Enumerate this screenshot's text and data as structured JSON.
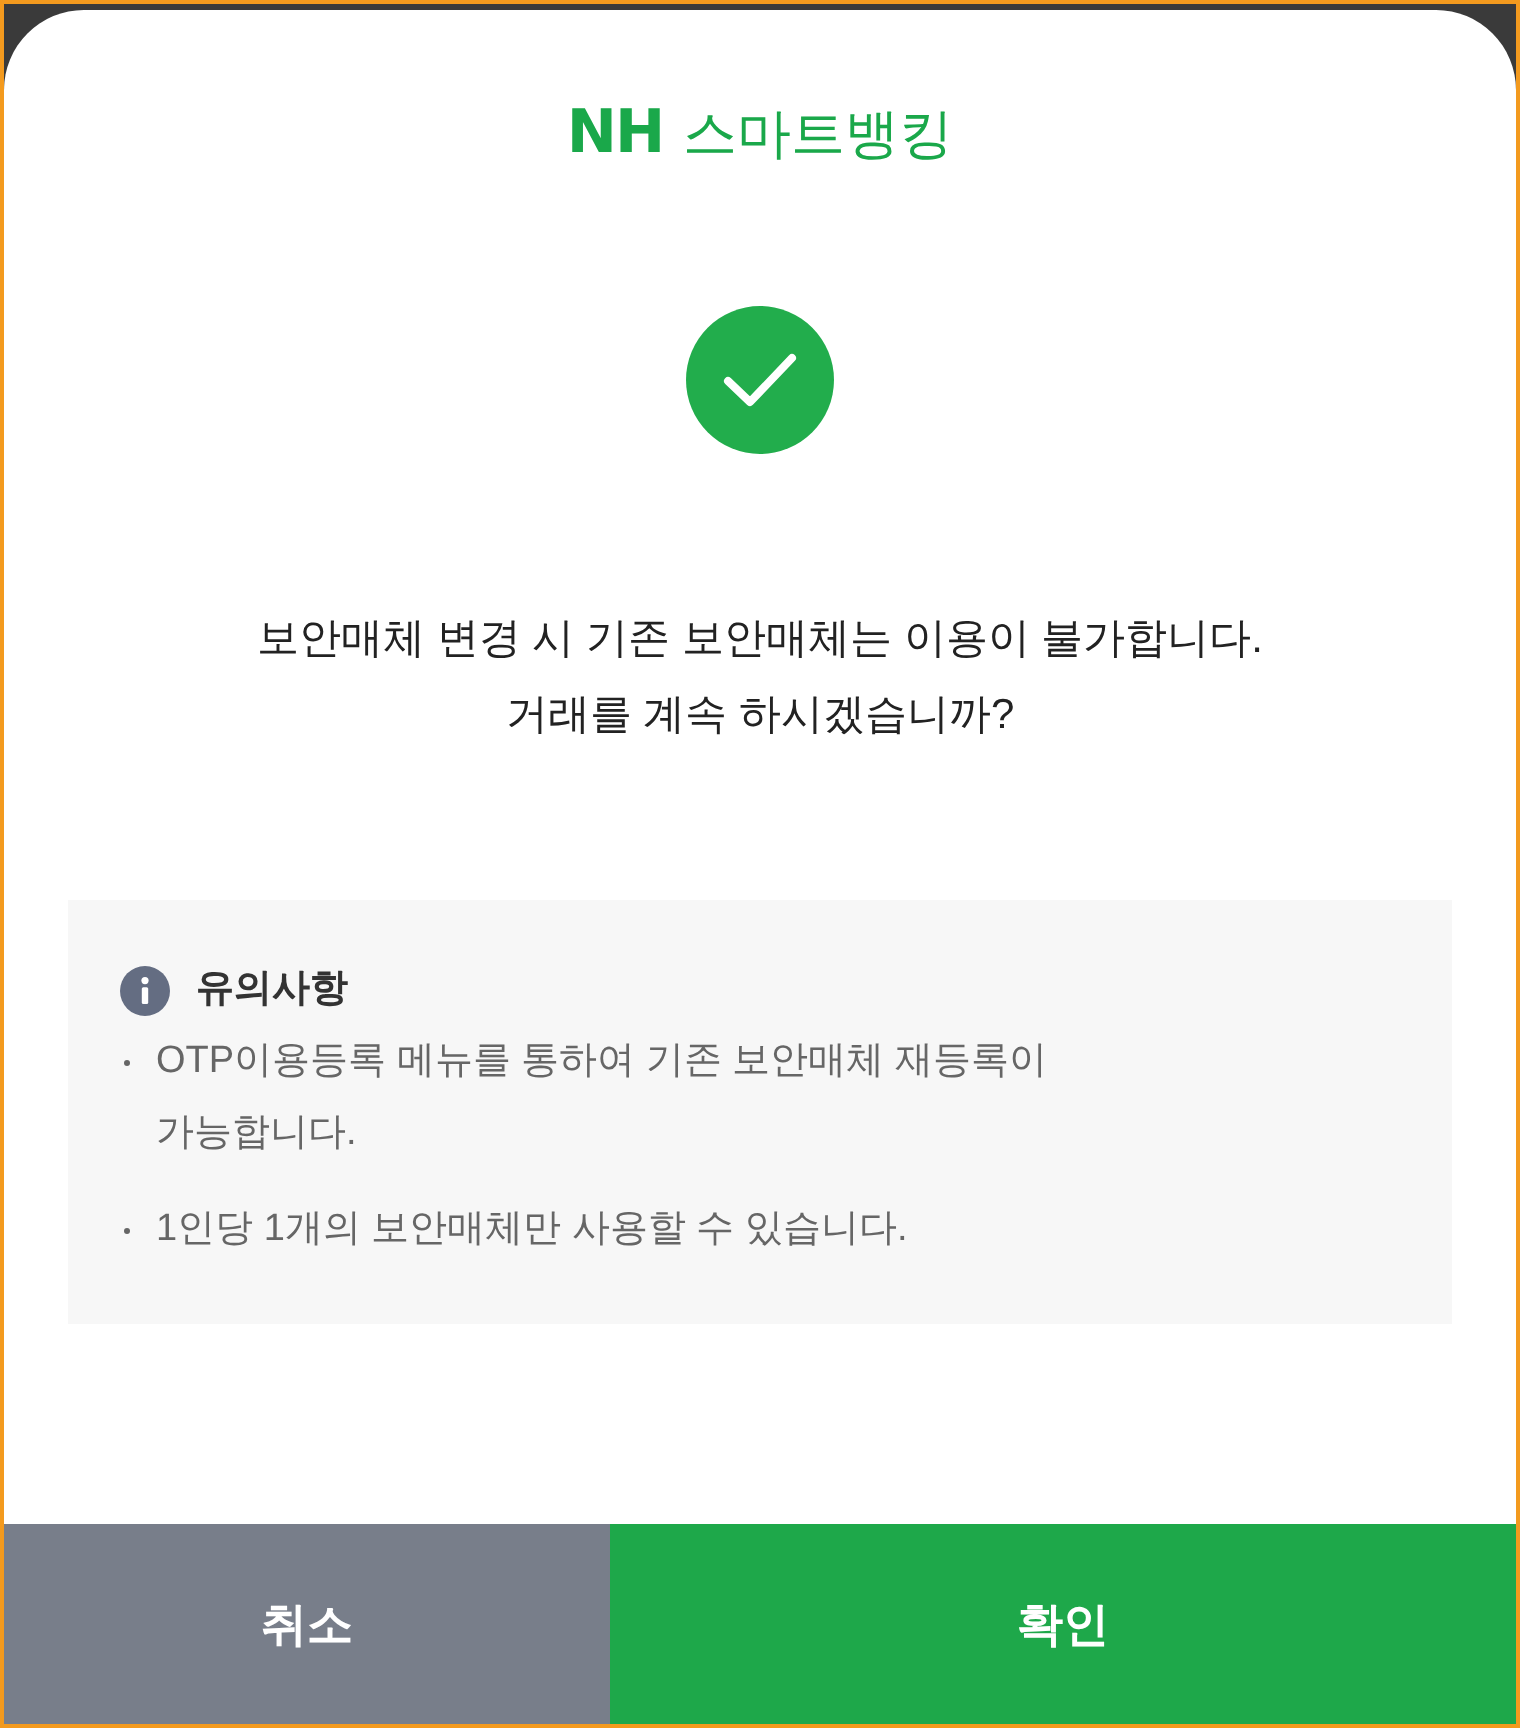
{
  "logo": {
    "brand": "NH",
    "service": "스마트뱅킹"
  },
  "status": {
    "kind": "success"
  },
  "message": "보안매체 변경 시 기존 보안매체는 이용이 불가합니다.\n거래를 계속 하시겠습니까?",
  "notice": {
    "title": "유의사항",
    "items": [
      "OTP이용등록 메뉴를 통하여 기존 보안매체 재등록이 가능합니다.",
      "1인당 1개의 보안매체만 사용할 수 있습니다."
    ]
  },
  "buttons": [
    {
      "label": "취소",
      "kind": "cancel"
    },
    {
      "label": "확인",
      "kind": "confirm"
    }
  ]
}
